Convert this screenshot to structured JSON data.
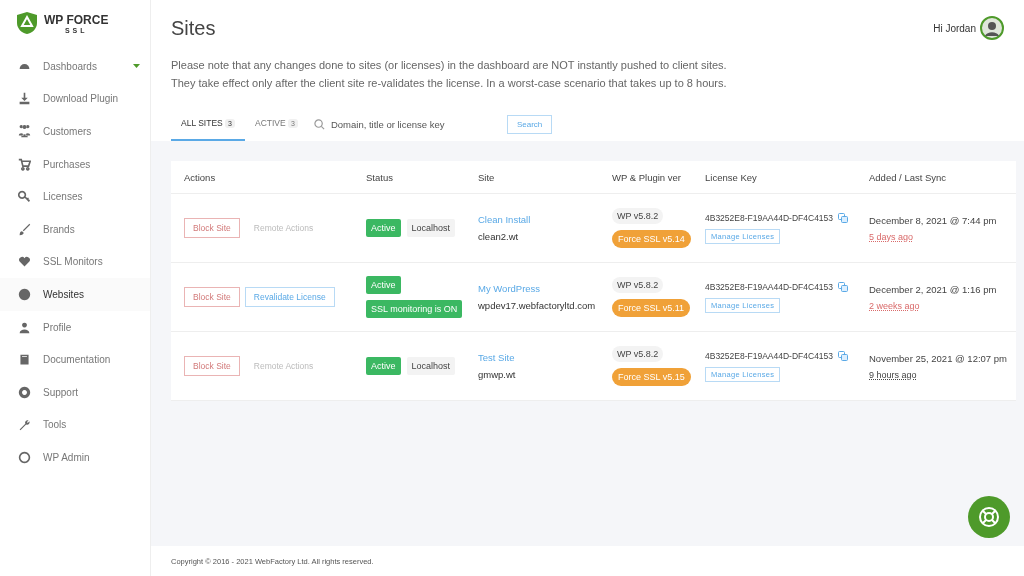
{
  "brand": {
    "name": "WP FORCE",
    "sub": "SSL"
  },
  "sidebar": {
    "items": [
      {
        "label": "Dashboards",
        "selected": false,
        "caret": true
      },
      {
        "label": "Download Plugin",
        "selected": false,
        "caret": false
      },
      {
        "label": "Customers",
        "selected": false,
        "caret": false
      },
      {
        "label": "Purchases",
        "selected": false,
        "caret": false
      },
      {
        "label": "Licenses",
        "selected": false,
        "caret": false
      },
      {
        "label": "Brands",
        "selected": false,
        "caret": false
      },
      {
        "label": "SSL Monitors",
        "selected": false,
        "caret": false
      },
      {
        "label": "Websites",
        "selected": true,
        "caret": false
      },
      {
        "label": "Profile",
        "selected": false,
        "caret": false
      },
      {
        "label": "Documentation",
        "selected": false,
        "caret": false
      },
      {
        "label": "Support",
        "selected": false,
        "caret": false
      },
      {
        "label": "Tools",
        "selected": false,
        "caret": false
      },
      {
        "label": "WP Admin",
        "selected": false,
        "caret": false
      }
    ]
  },
  "header": {
    "title": "Sites",
    "greeting": "Hi Jordan"
  },
  "notice": [
    "Please note that any changes done to sites (or licenses) in the dashboard are NOT instantly pushed to client sites.",
    "They take effect only after the client site re-validates the license. In a worst-case scenario that takes up to 8 hours."
  ],
  "tabs": [
    {
      "label": "ALL SITES",
      "count": "3",
      "selected": true
    },
    {
      "label": "ACTIVE",
      "count": "3",
      "selected": false
    }
  ],
  "search": {
    "placeholder": "Domain, title or license key",
    "button": "Search"
  },
  "table": {
    "columns": [
      "Actions",
      "Status",
      "Site",
      "WP & Plugin ver",
      "License Key",
      "Added / Last Sync"
    ],
    "rows": [
      {
        "actions": [
          {
            "kind": "block",
            "label": "Block Site",
            "disabled": false
          },
          {
            "kind": "remote",
            "label": "Remote Actions",
            "disabled": true
          }
        ],
        "status": [
          {
            "kind": "active",
            "label": "Active"
          },
          {
            "kind": "tag",
            "label": "Localhost"
          }
        ],
        "title": "Clean Install",
        "domain": "clean2.wt",
        "wp": "WP v5.8.2",
        "plugin": "Force SSL v5.14",
        "key": "4B3252E8-F19AA44D-DF4C4153",
        "manage": "Manage Licenses",
        "added": "December 8, 2021 @ 7:44 pm",
        "sync": "5 days ago",
        "stale": true
      },
      {
        "actions": [
          {
            "kind": "block",
            "label": "Block Site",
            "disabled": false
          },
          {
            "kind": "revalidate",
            "label": "Revalidate License",
            "disabled": false
          }
        ],
        "status": [
          {
            "kind": "active",
            "label": "Active"
          },
          {
            "kind": "active",
            "label": "SSL monitoring is ON"
          }
        ],
        "title": "My WordPress",
        "domain": "wpdev17.webfactoryltd.com",
        "wp": "WP v5.8.2",
        "plugin": "Force SSL v5.11",
        "key": "4B3252E8-F19AA44D-DF4C4153",
        "manage": "Manage Licenses",
        "added": "December 2, 2021 @ 1:16 pm",
        "sync": "2 weeks ago",
        "stale": true
      },
      {
        "actions": [
          {
            "kind": "block",
            "label": "Block Site",
            "disabled": false
          },
          {
            "kind": "remote",
            "label": "Remote Actions",
            "disabled": true
          }
        ],
        "status": [
          {
            "kind": "active",
            "label": "Active"
          },
          {
            "kind": "tag",
            "label": "Localhost"
          }
        ],
        "title": "Test Site",
        "domain": "gmwp.wt",
        "wp": "WP v5.8.2",
        "plugin": "Force SSL v5.15",
        "key": "4B3252E8-F19AA44D-DF4C4153",
        "manage": "Manage Licenses",
        "added": "November 25, 2021 @ 12:07 pm",
        "sync": "9 hours ago",
        "stale": false
      }
    ]
  },
  "footer": "Copyright © 2016 - 2021 WebFactory Ltd. All rights reserved."
}
